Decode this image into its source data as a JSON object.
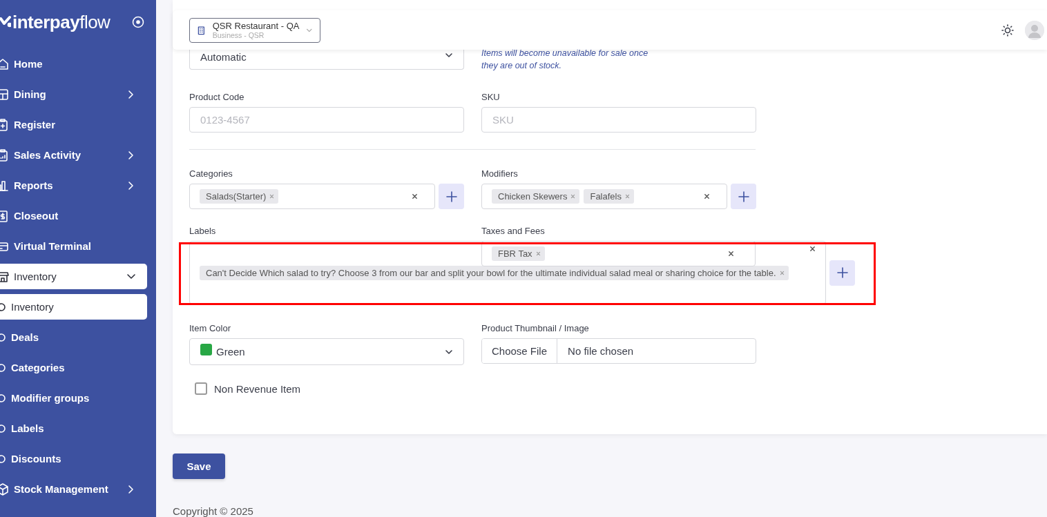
{
  "sidebar": {
    "logo": "**interpay**flow",
    "items": [
      {
        "label": "Home",
        "kind": "link",
        "selected": false
      },
      {
        "label": "Dining",
        "kind": "menu",
        "expanded": false,
        "selected": false
      },
      {
        "label": "Register",
        "kind": "link",
        "selected": false
      },
      {
        "label": "Sales Activity",
        "kind": "menu",
        "expanded": false,
        "selected": false
      },
      {
        "label": "Reports",
        "kind": "menu",
        "expanded": false,
        "selected": false
      },
      {
        "label": "Closeout",
        "kind": "link",
        "selected": false
      },
      {
        "label": "Virtual Terminal",
        "kind": "link",
        "selected": false
      },
      {
        "label": "Inventory",
        "kind": "menu",
        "expanded": true,
        "selected": true
      },
      {
        "label": "Inventory",
        "kind": "sub",
        "selected": true
      },
      {
        "label": "Deals",
        "kind": "sub",
        "selected": false
      },
      {
        "label": "Categories",
        "kind": "sub",
        "selected": false
      },
      {
        "label": "Modifier groups",
        "kind": "sub",
        "selected": false
      },
      {
        "label": "Labels",
        "kind": "sub",
        "selected": false
      },
      {
        "label": "Discounts",
        "kind": "sub",
        "selected": false
      },
      {
        "label": "Stock Management",
        "kind": "menu",
        "expanded": false,
        "selected": false
      }
    ]
  },
  "top_bar": {
    "business": {
      "name": "QSR Restaurant - QA",
      "subtitle": "Business - QSR"
    }
  },
  "form": {
    "stock_mode": {
      "value": "Automatic",
      "help": "Items will become unavailable for sale once they are out of stock."
    },
    "product_code": {
      "label": "Product Code",
      "placeholder": "0123-4567"
    },
    "sku": {
      "label": "SKU",
      "placeholder": "SKU"
    },
    "categories": {
      "label": "Categories",
      "tags": [
        "Salads(Starter)"
      ]
    },
    "modifiers": {
      "label": "Modifiers",
      "tags": [
        "Chicken Skewers",
        "Falafels"
      ]
    },
    "labels": {
      "label": "Labels",
      "tags": [
        "Can't Decide Which salad to try? Choose 3 from our bar and split your bowl for the ultimate individual salad meal or sharing choice for the table."
      ]
    },
    "taxes": {
      "label": "Taxes and Fees",
      "tags": [
        "FBR Tax"
      ]
    },
    "item_color": {
      "label": "Item Color",
      "value": "Green",
      "color": "#28a745"
    },
    "thumbnail": {
      "label": "Product Thumbnail / Image",
      "button": "Choose File",
      "status": "No file chosen"
    },
    "non_revenue": {
      "label": "Non Revenue Item",
      "checked": false
    }
  },
  "save": "Save",
  "footer": "Copyright © 2025"
}
